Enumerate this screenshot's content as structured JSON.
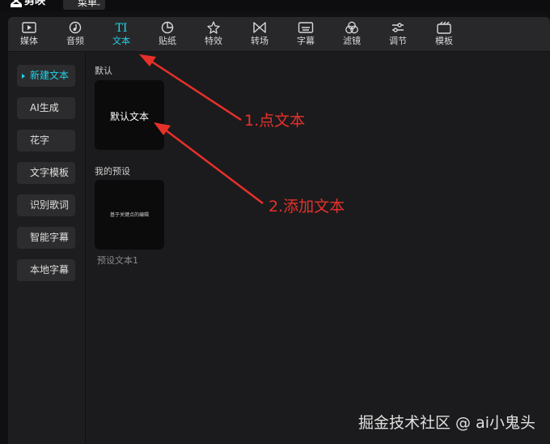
{
  "app": {
    "title": "剪映",
    "menu_label": "菜单"
  },
  "toolbar": {
    "items": [
      {
        "label": "媒体",
        "icon": "media-icon"
      },
      {
        "label": "音频",
        "icon": "audio-icon"
      },
      {
        "label": "文本",
        "icon": "text-icon",
        "icon_text": "TI",
        "active": true
      },
      {
        "label": "贴纸",
        "icon": "sticker-icon"
      },
      {
        "label": "特效",
        "icon": "effects-icon"
      },
      {
        "label": "转场",
        "icon": "transition-icon"
      },
      {
        "label": "字幕",
        "icon": "subtitle-icon"
      },
      {
        "label": "滤镜",
        "icon": "filter-icon"
      },
      {
        "label": "调节",
        "icon": "adjust-icon"
      },
      {
        "label": "模板",
        "icon": "template-icon"
      }
    ]
  },
  "sidebar": {
    "items": [
      {
        "label": "新建文本",
        "active": true
      },
      {
        "label": "AI生成"
      },
      {
        "label": "花字"
      },
      {
        "label": "文字模板"
      },
      {
        "label": "识别歌词"
      },
      {
        "label": "智能字幕"
      },
      {
        "label": "本地字幕"
      }
    ]
  },
  "content": {
    "default_section": {
      "title": "默认",
      "card_text": "默认文本"
    },
    "preset_section": {
      "title": "我的预设",
      "card_text": "基于关键点的编辑",
      "caption": "预设文本1"
    }
  },
  "annotations": {
    "step1": "1.点文本",
    "step2": "2.添加文本",
    "arrow_color": "#e8302a"
  },
  "watermark": "掘金技术社区 @ ai小鬼头",
  "colors": {
    "accent": "#22d3e6",
    "panel_bg": "#1d1d1f",
    "card_bg": "#0b0b0c"
  }
}
